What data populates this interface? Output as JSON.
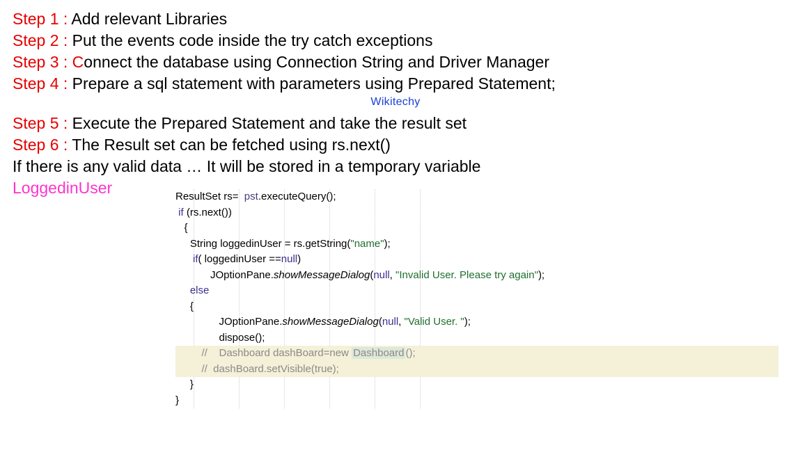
{
  "steps": {
    "s1_label": "Step 1 : ",
    "s1_text": "Add relevant Libraries",
    "s2_label": "Step 2 : ",
    "s2_text": "Put the events code inside the try catch exceptions",
    "s3_label": "Step 3 : ",
    "s3_big_c": "C",
    "s3_text": "onnect the database using Connection String and Driver Manager",
    "s4_label": "Step 4 : ",
    "s4_text": "Prepare a sql statement with parameters using Prepared Statement;",
    "s5_label": "Step 5 : ",
    "s5_text": "Execute the Prepared Statement and take the result set",
    "s6_label": "Step 6 : ",
    "s6_text": "The Result set can be fetched using rs.next()"
  },
  "watermark": "Wikitechy",
  "note": "If there is any valid data … It will be stored in a temporary variable",
  "pink_word": "LoggedinUser",
  "code": {
    "l1_a": "ResultSet rs=  ",
    "l1_b": "pst",
    "l1_c": ".executeQuery();",
    "l2_a": " ",
    "l2_kw": "if",
    "l2_b": " (rs.next())",
    "l3": "   {",
    "l4_a": "     String loggedinUser = rs.getString(",
    "l4_str": "\"name\"",
    "l4_b": ");",
    "l5_a": "      ",
    "l5_kw": "if",
    "l5_b": "( loggedinUser ==",
    "l5_null": "null",
    "l5_c": ")",
    "l6_a": "            JOptionPane.",
    "l6_i": "showMessageDialog",
    "l6_b": "(",
    "l6_null": "null",
    "l6_c": ", ",
    "l6_str": "\"Invalid User. Please try again\"",
    "l6_d": ");",
    "l7_a": "     ",
    "l7_kw": "else",
    "l8": "     {",
    "l9_a": "               JOptionPane.",
    "l9_i": "showMessageDialog",
    "l9_b": "(",
    "l9_null": "null",
    "l9_c": ", ",
    "l9_str": "\"Valid User. \"",
    "l9_d": ");",
    "l10": "               dispose();",
    "l11_a": "         //    Dashboard dashBoard=",
    "l11_kw": "new",
    "l11_b": " ",
    "l11_dash": "Dashboard",
    "l11_c": "();",
    "l12": "         //  dashBoard.setVisible(true);",
    "l13": "     }",
    "l14": "}"
  }
}
